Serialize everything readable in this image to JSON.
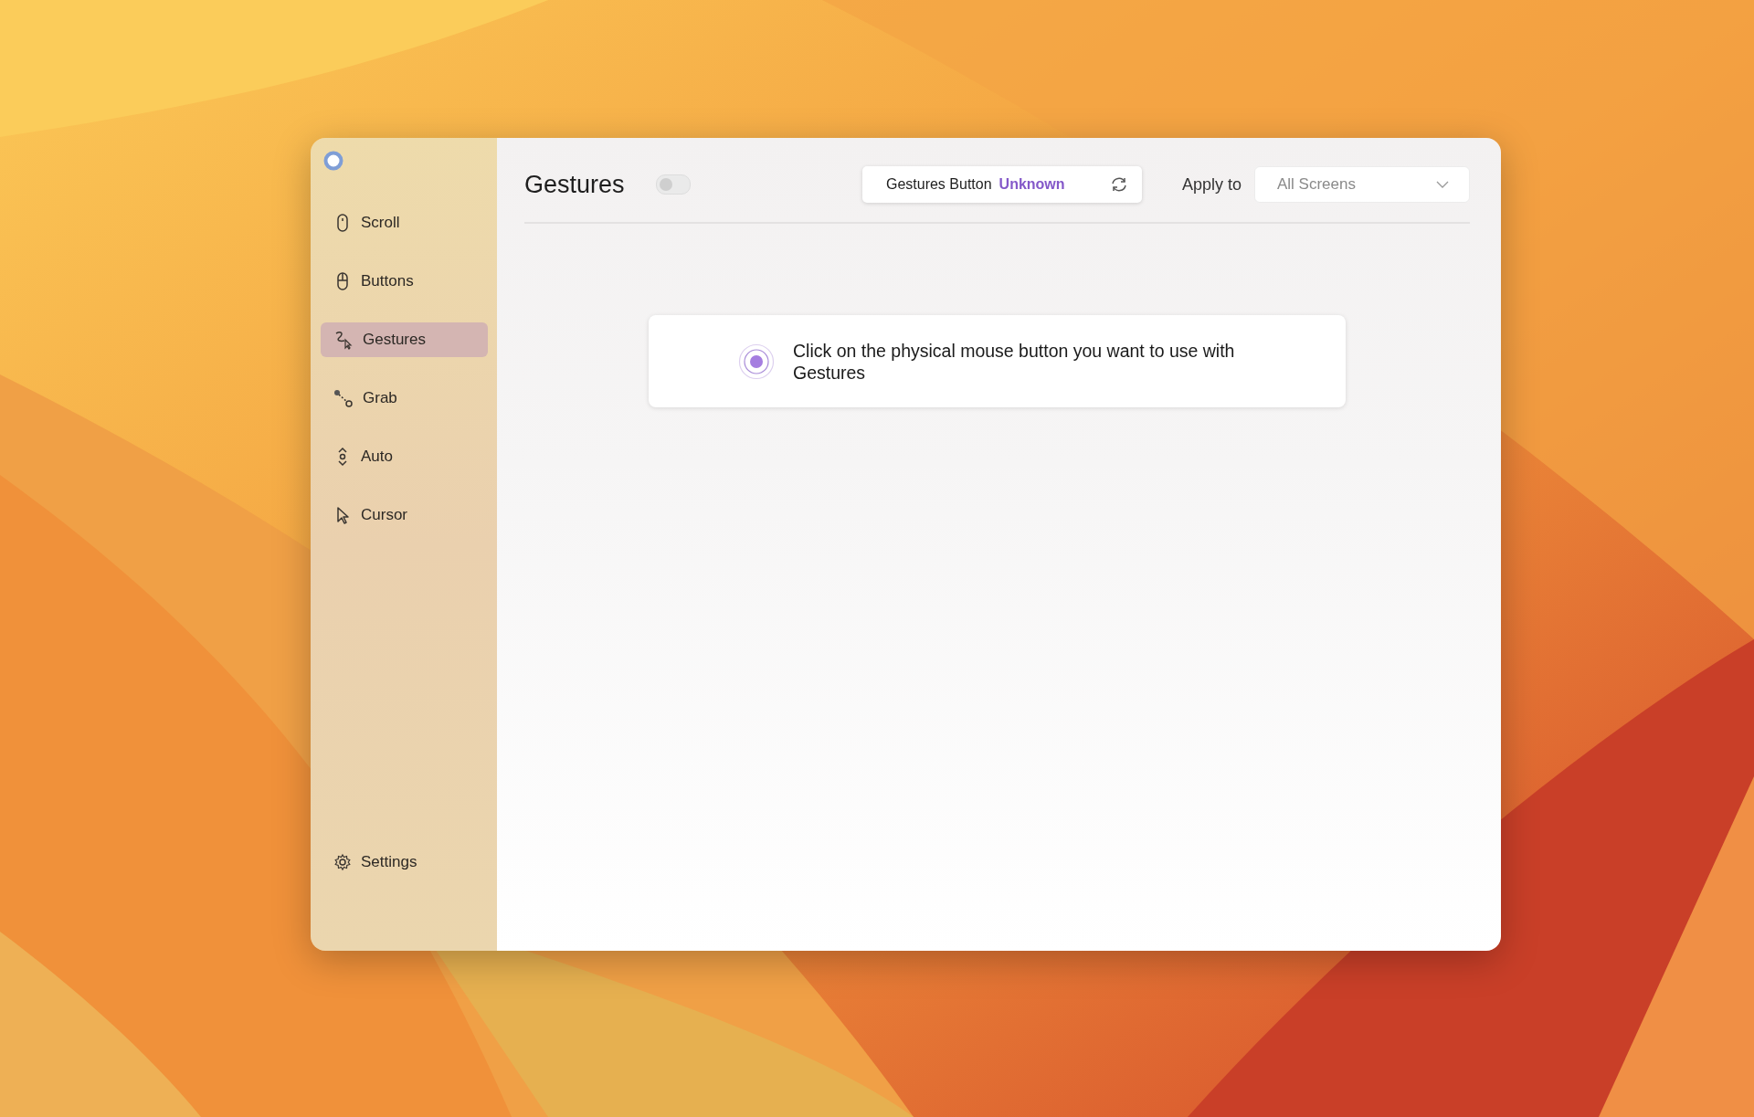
{
  "sidebar": {
    "items": [
      {
        "label": "Scroll",
        "selected": false
      },
      {
        "label": "Buttons",
        "selected": false
      },
      {
        "label": "Gestures",
        "selected": true
      },
      {
        "label": "Grab",
        "selected": false
      },
      {
        "label": "Auto",
        "selected": false
      },
      {
        "label": "Cursor",
        "selected": false
      }
    ],
    "footer": {
      "label": "Settings"
    }
  },
  "header": {
    "title": "Gestures",
    "enabled": {
      "on": false
    },
    "gestures_button": {
      "label": "Gestures Button",
      "value": "Unknown"
    },
    "apply_to": {
      "label": "Apply to",
      "value": "All Screens"
    }
  },
  "prompt": {
    "text": "Click on the physical mouse button you want to use with Gestures"
  }
}
